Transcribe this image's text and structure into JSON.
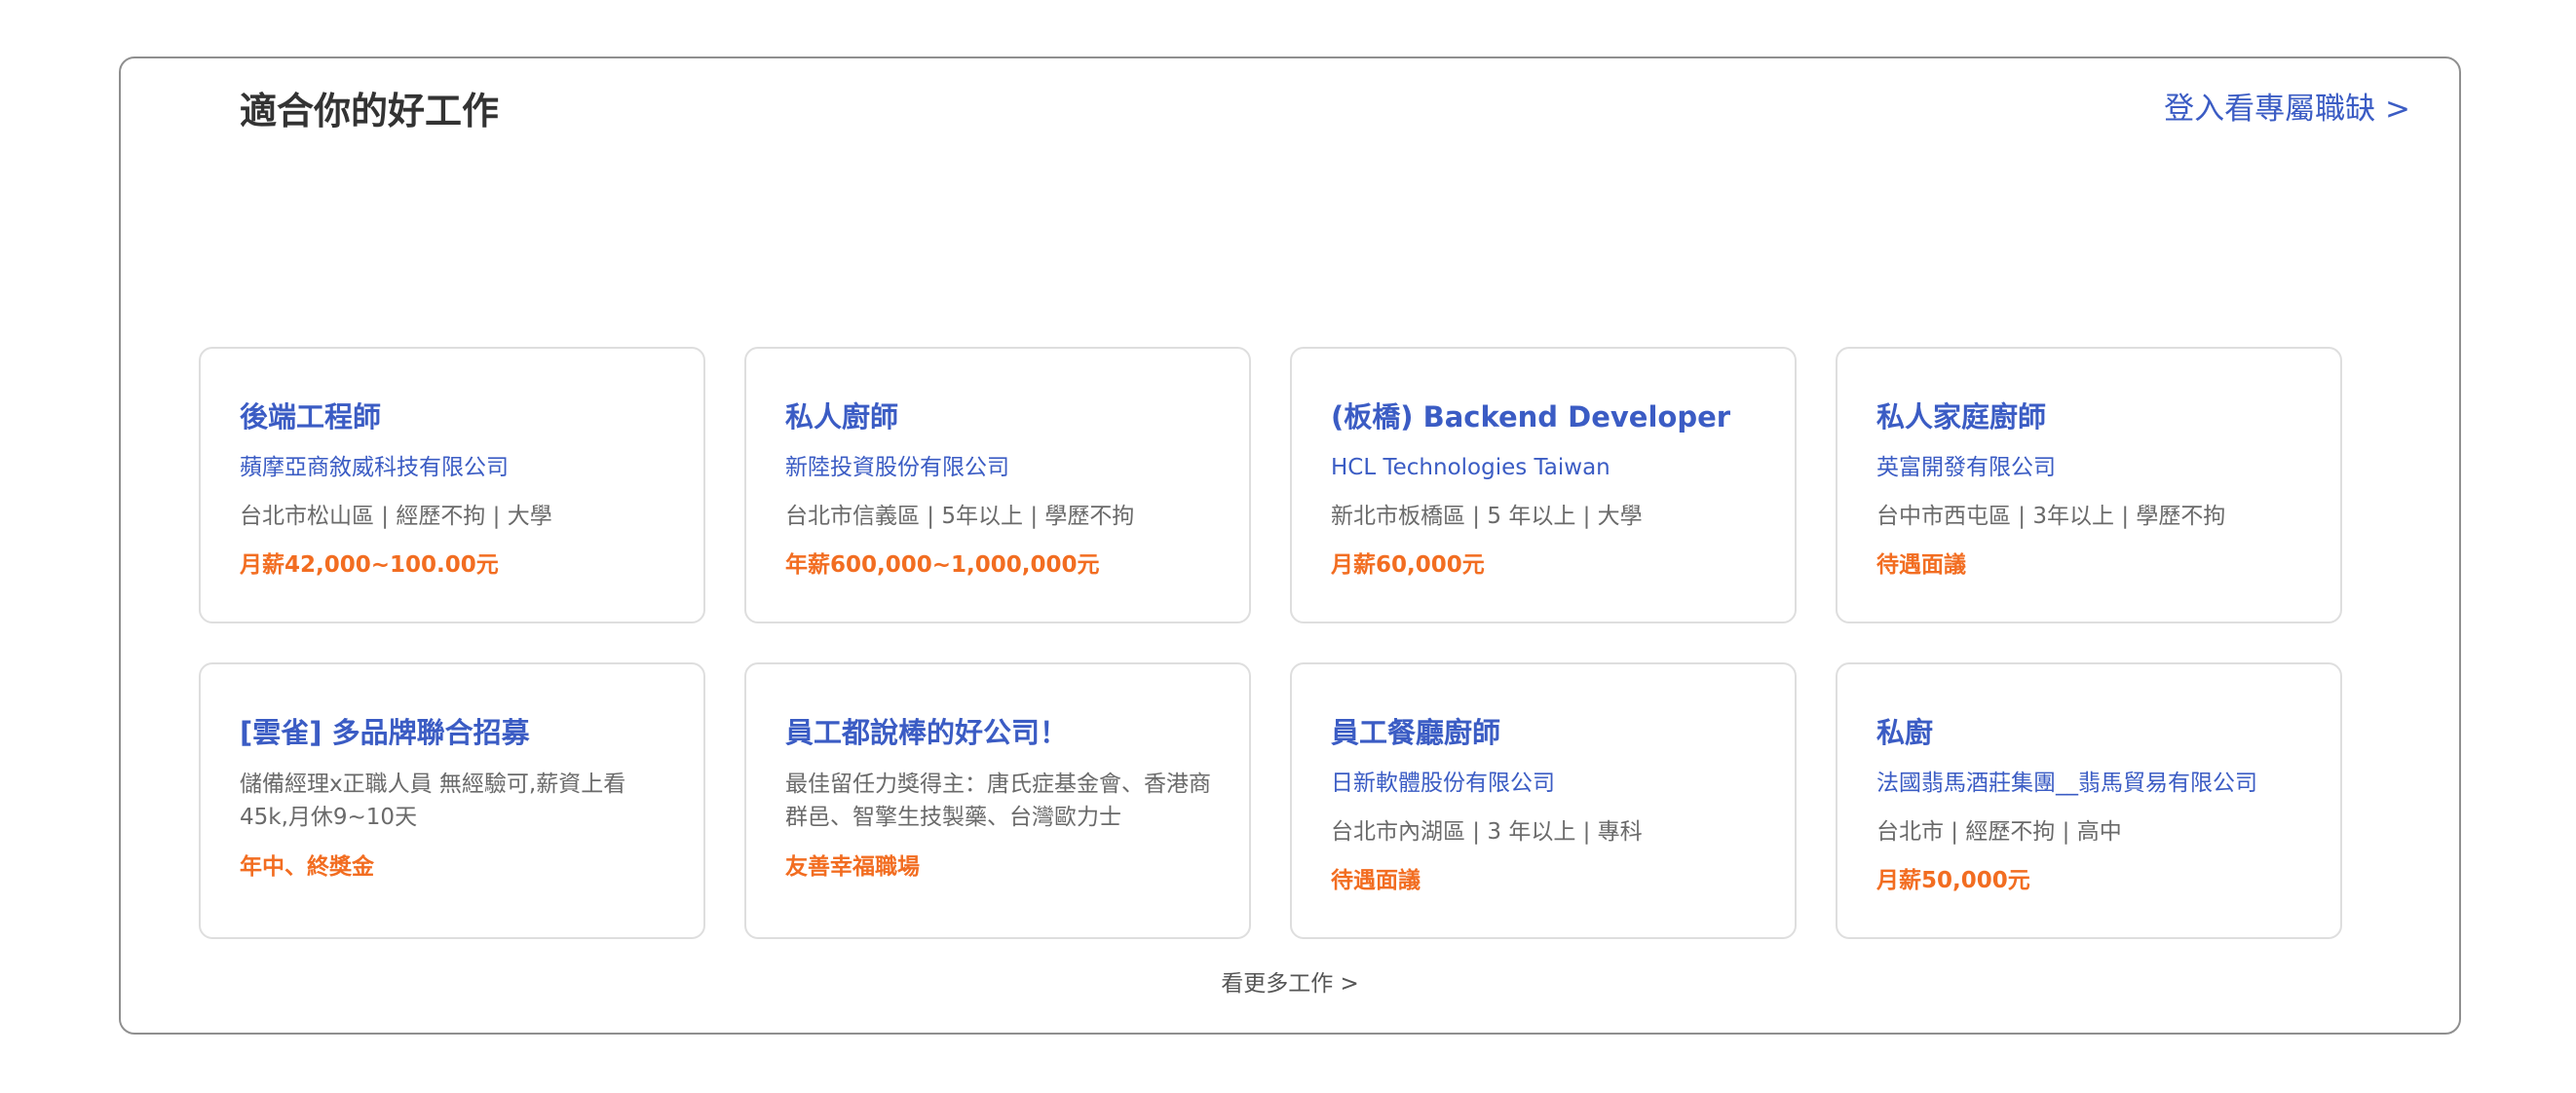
{
  "section": {
    "title": "適合你的好工作",
    "login_link": "登入看專屬職缺 >",
    "more_link": "看更多工作 >"
  },
  "jobs": [
    {
      "title": "後端工程師",
      "company": "蘋摩亞商敘威科技有限公司",
      "meta": "台北市松山區 | 經歷不拘 | 大學",
      "salary": "月薪42,000~100.00元"
    },
    {
      "title": "私人廚師",
      "company": "新陸投資股份有限公司",
      "meta": "台北市信義區 | 5年以上 | 學歷不拘",
      "salary": "年薪600,000~1,000,000元"
    },
    {
      "title": "(板橋) Backend Developer",
      "company": "HCL Technologies Taiwan",
      "meta": "新北市板橋區 | 5 年以上 | 大學",
      "salary": "月薪60,000元"
    },
    {
      "title": "私人家庭廚師",
      "company": "英富開發有限公司",
      "meta": "台中市西屯區 | 3年以上 | 學歷不拘",
      "salary": "待遇面議"
    },
    {
      "title": "[雲雀] 多品牌聯合招募",
      "desc": "儲備經理x正職人員 無經驗可,薪資上看45k,月休9~10天",
      "salary": "年中、終獎金"
    },
    {
      "title": "員工都說棒的好公司！",
      "desc": "最佳留任力獎得主：唐氏症基金會、香港商群邑、智擎生技製藥、台灣歐力士",
      "salary": "友善幸福職場"
    },
    {
      "title": "員工餐廳廚師",
      "company": "日新軟體股份有限公司",
      "meta": "台北市內湖區 | 3 年以上 | 專科",
      "salary": "待遇面議"
    },
    {
      "title": "私廚",
      "company": "法國翡馬酒莊集團__翡馬貿易有限公司",
      "meta": "台北市 | 經歷不拘 | 高中",
      "salary": "月薪50,000元"
    }
  ],
  "colors": {
    "accent": "#3b5cc4",
    "salary": "#f26d21",
    "muted_text": "#6a6a6a",
    "title_text": "#333333",
    "panel_border": "#8f8f8f",
    "card_border": "#dedede"
  }
}
